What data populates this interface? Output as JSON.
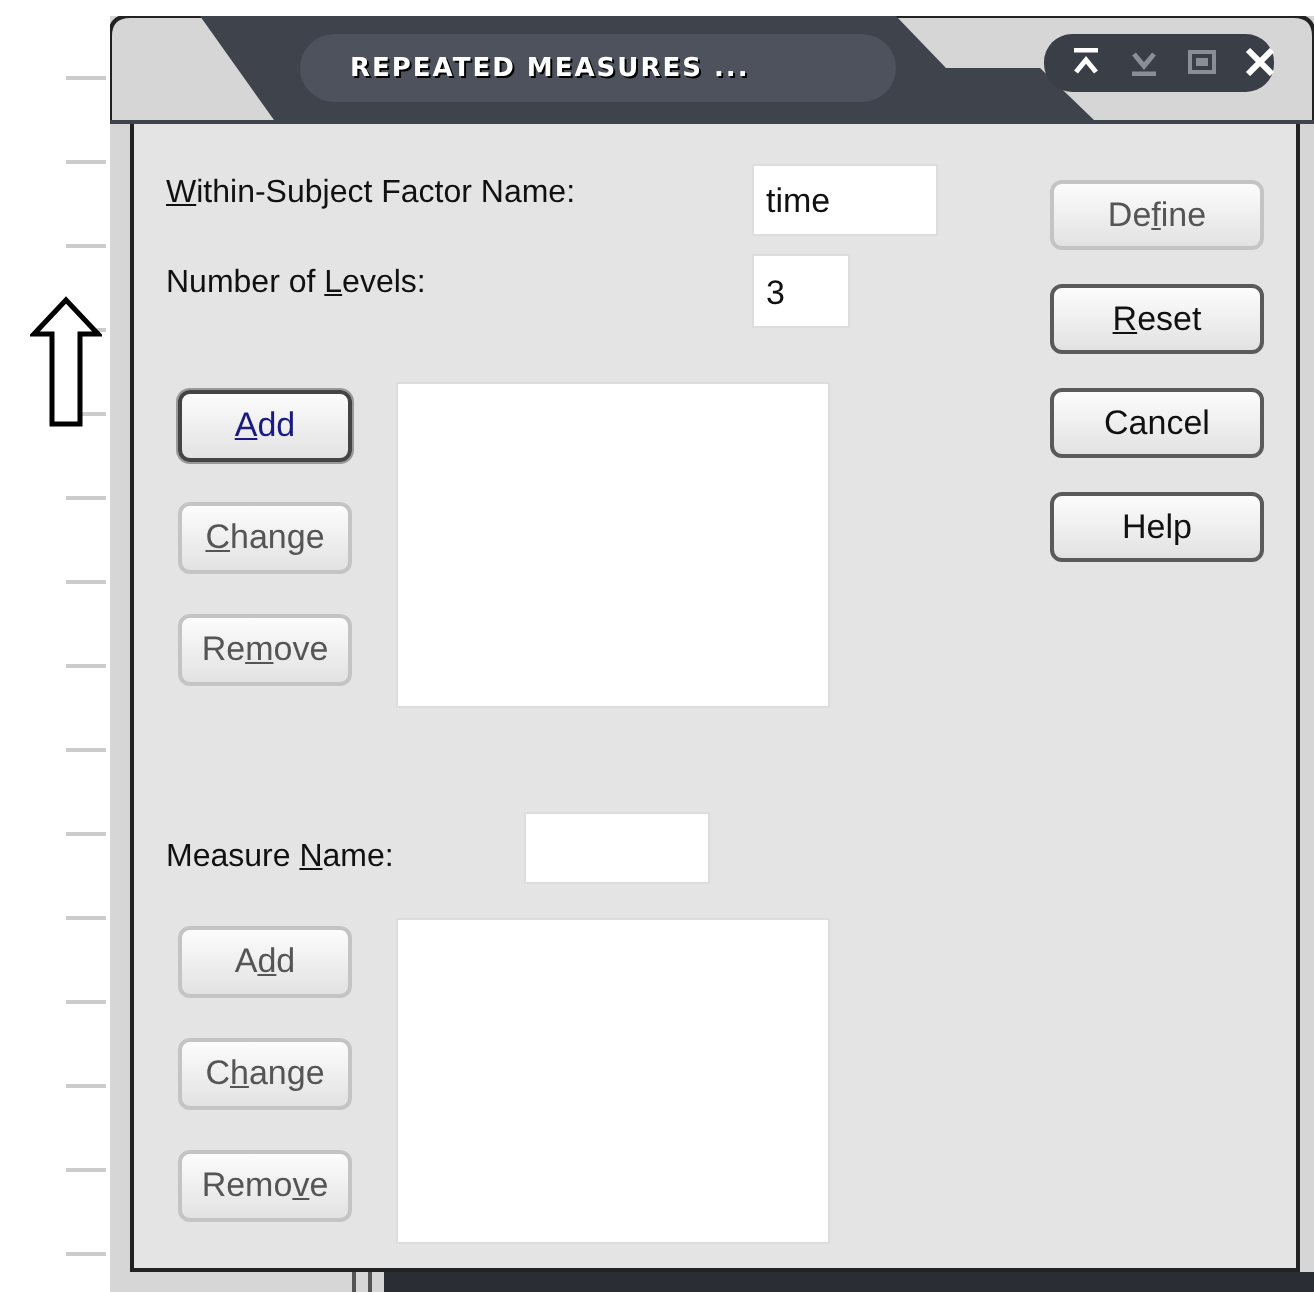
{
  "window": {
    "title": "REPEATED MEASURES ..."
  },
  "factor": {
    "name_label": {
      "key": "W",
      "post": "ithin-Subject Factor Name:"
    },
    "name_value": "time",
    "levels_label": {
      "pre": "Number of ",
      "key": "L",
      "post": "evels:"
    },
    "levels_value": "3",
    "buttons": [
      {
        "label": {
          "key": "A",
          "post": "dd"
        },
        "default": true,
        "disabled": false
      },
      {
        "label": {
          "key": "C",
          "post": "hange"
        },
        "default": false,
        "disabled": true
      },
      {
        "label": {
          "pre": "Re",
          "key": "m",
          "post": "ove"
        },
        "default": false,
        "disabled": true
      }
    ]
  },
  "measure": {
    "name_label": {
      "pre": "Measure ",
      "key": "N",
      "post": "ame:"
    },
    "buttons": [
      {
        "label": {
          "pre": "A",
          "key": "d",
          "post": "d"
        },
        "default": false,
        "disabled": true
      },
      {
        "label": {
          "pre": "C",
          "key": "h",
          "post": "ange"
        },
        "default": false,
        "disabled": true
      },
      {
        "label": {
          "pre": "Remo",
          "key": "v",
          "post": "e"
        },
        "default": false,
        "disabled": true
      }
    ]
  },
  "side_buttons": [
    {
      "label": {
        "pre": "De",
        "key": "f",
        "post": "ine"
      },
      "default": false,
      "disabled": true
    },
    {
      "label": {
        "key": "R",
        "post": "eset"
      },
      "default": false,
      "disabled": false
    },
    {
      "label": {
        "pre": "Cancel"
      },
      "default": false,
      "disabled": false
    },
    {
      "label": {
        "pre": "Help"
      },
      "default": false,
      "disabled": false
    }
  ]
}
